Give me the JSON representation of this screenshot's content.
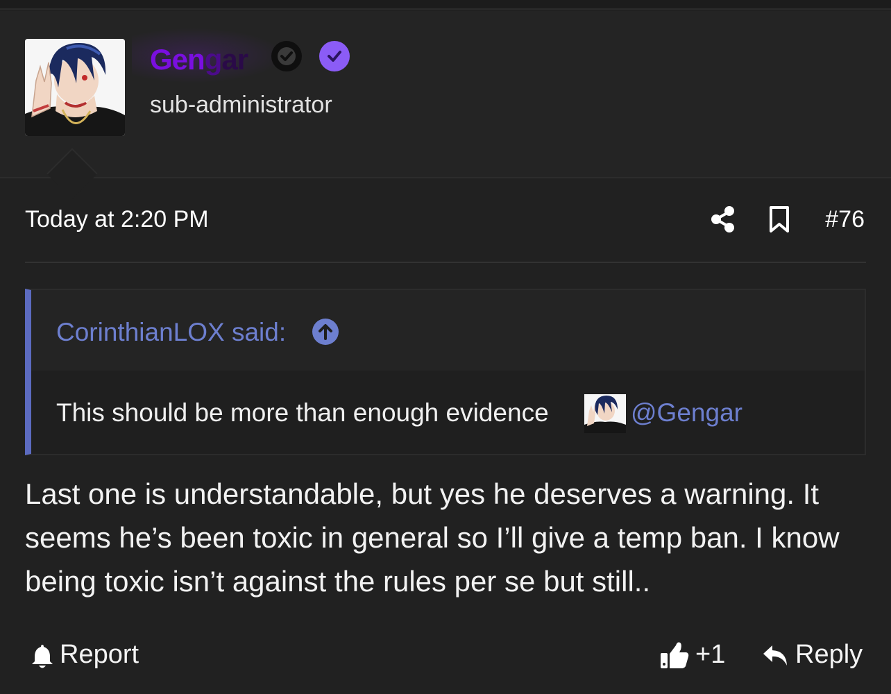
{
  "user": {
    "name_part1": "Gen",
    "name_part2": "g",
    "name_part3": "ar",
    "role": "sub-administrator",
    "avatar_icon": "anime-character-avatar",
    "badges": [
      "verified-badge-black",
      "verified-badge-purple"
    ],
    "name_colors": [
      "#7a0fe0",
      "#4b0b8a",
      "#2a0a48"
    ]
  },
  "post": {
    "date": "Today at 2:20 PM",
    "number": "#76",
    "share_icon": "share-icon",
    "bookmark_icon": "bookmark-icon",
    "body": "Last one is understandable, but yes he deserves a warning. It seems he’s been toxic in general so I’ll give a temp ban. I know being toxic isn’t against the rules per se but still.."
  },
  "quote": {
    "author": "CorinthianLOX said:",
    "jump_icon": "arrow-up-circle-icon",
    "text": "This should be more than enough evidence",
    "mention": "@Gengar",
    "accent": "#5c6bc0"
  },
  "actions": {
    "report": "Report",
    "like_count": "+1",
    "reply": "Reply"
  },
  "colors": {
    "background": "#212121",
    "link": "#6d7fcf",
    "badge_purple": "#8b5cf6"
  }
}
